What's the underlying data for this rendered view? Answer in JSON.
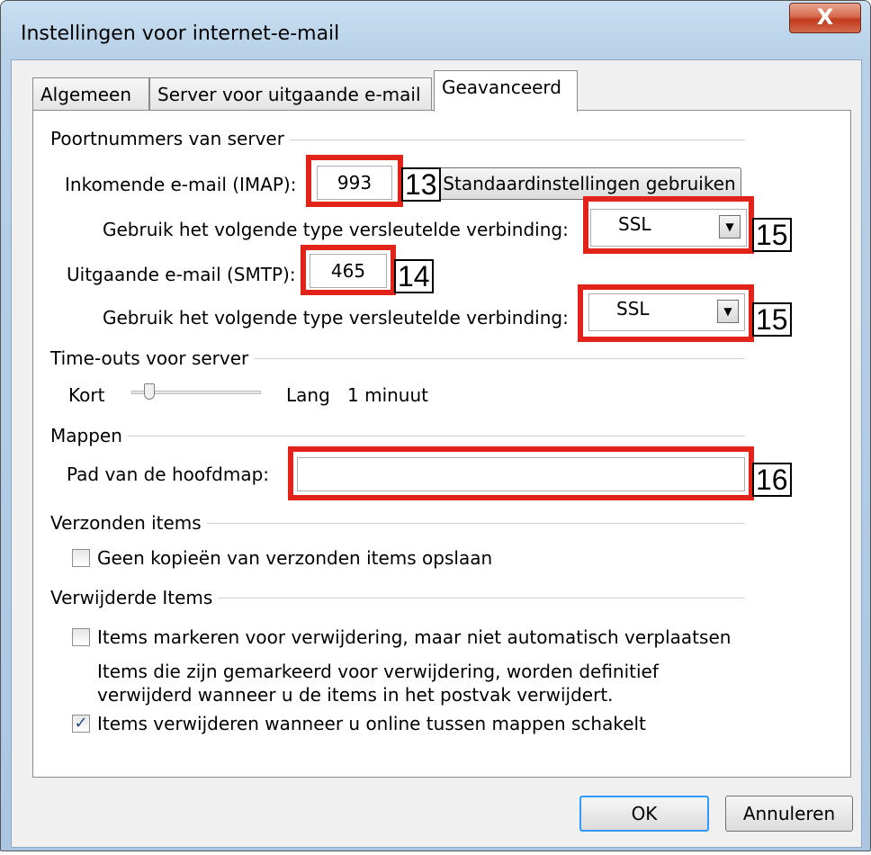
{
  "window": {
    "title": "Instellingen voor internet-e-mail",
    "close_glyph": "X"
  },
  "tabs": [
    {
      "label": "Algemeen"
    },
    {
      "label": "Server voor uitgaande e-mail"
    },
    {
      "label": "Geavanceerd"
    }
  ],
  "ports": {
    "group_title": "Poortnummers van server",
    "incoming_label": "Inkomende e-mail (IMAP):",
    "incoming_value": "993",
    "defaults_button": "Standaardinstellingen gebruiken",
    "encryption_label_1": "Gebruik het volgende type versleutelde verbinding:",
    "encryption_value_1": "SSL",
    "outgoing_label": "Uitgaande e-mail (SMTP):",
    "outgoing_value": "465",
    "encryption_label_2": "Gebruik het volgende type versleutelde verbinding:",
    "encryption_value_2": "SSL"
  },
  "timeouts": {
    "group_title": "Time-outs voor server",
    "short_label": "Kort",
    "long_label": "Lang",
    "value": "1 minuut"
  },
  "folders": {
    "group_title": "Mappen",
    "root_label": "Pad van de hoofdmap:",
    "root_value": ""
  },
  "sent": {
    "group_title": "Verzonden items",
    "no_copies_label": "Geen kopieën van verzonden items opslaan",
    "no_copies_checked": false
  },
  "deleted": {
    "group_title": "Verwijderde Items",
    "mark_label": "Items markeren voor verwijdering, maar niet automatisch verplaatsen",
    "mark_checked": false,
    "info_line_1": "Items die zijn gemarkeerd voor verwijdering, worden definitief",
    "info_line_2": "verwijderd wanneer u de items in het postvak verwijdert.",
    "purge_label": "Items verwijderen wanneer u online tussen mappen schakelt",
    "purge_checked": true
  },
  "annotations": {
    "badge_13": "13",
    "badge_14": "14",
    "badge_15a": "15",
    "badge_15b": "15",
    "badge_16": "16",
    "marker_color": "#e2231a"
  },
  "buttons": {
    "ok": "OK",
    "cancel": "Annuleren"
  },
  "icons": {
    "checkmark": "✓",
    "dropdown": "▼",
    "close": "X"
  }
}
